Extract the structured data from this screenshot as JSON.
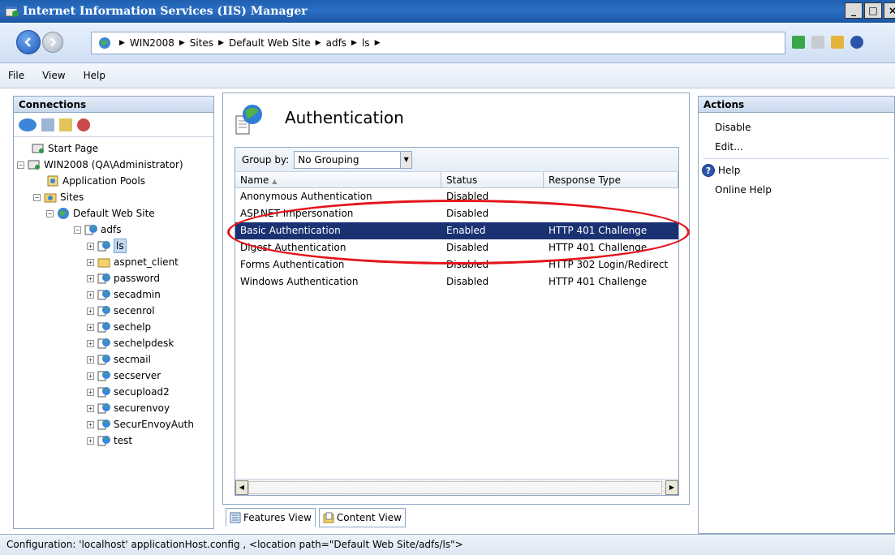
{
  "window": {
    "title": "Internet Information Services (IIS) Manager"
  },
  "address": {
    "crumbs": [
      "WIN2008",
      "Sites",
      "Default Web Site",
      "adfs",
      "ls"
    ]
  },
  "menu": {
    "file": "File",
    "view": "View",
    "help": "Help"
  },
  "connections": {
    "header": "Connections",
    "tree": {
      "start_page": "Start Page",
      "server": "WIN2008 (QA\\Administrator)",
      "app_pools": "Application Pools",
      "sites": "Sites",
      "default_site": "Default Web Site",
      "adfs": "adfs",
      "ls": "ls",
      "children": [
        "aspnet_client",
        "password",
        "secadmin",
        "secenrol",
        "sechelp",
        "sechelpdesk",
        "secmail",
        "secserver",
        "secupload2",
        "securenvoy",
        "SecurEnvoyAuth",
        "test"
      ]
    }
  },
  "feature": {
    "title": "Authentication",
    "group_by_label": "Group by:",
    "group_by_value": "No Grouping",
    "columns": [
      "Name",
      "Status",
      "Response Type"
    ],
    "rows": [
      {
        "name": "Anonymous Authentication",
        "status": "Disabled",
        "response": ""
      },
      {
        "name": "ASP.NET Impersonation",
        "status": "Disabled",
        "response": ""
      },
      {
        "name": "Basic Authentication",
        "status": "Enabled",
        "response": "HTTP 401 Challenge"
      },
      {
        "name": "Digest Authentication",
        "status": "Disabled",
        "response": "HTTP 401 Challenge"
      },
      {
        "name": "Forms Authentication",
        "status": "Disabled",
        "response": "HTTP 302 Login/Redirect"
      },
      {
        "name": "Windows Authentication",
        "status": "Disabled",
        "response": "HTTP 401 Challenge"
      }
    ]
  },
  "view_tabs": {
    "features": "Features View",
    "content": "Content View"
  },
  "actions": {
    "header": "Actions",
    "disable": "Disable",
    "edit": "Edit...",
    "help": "Help",
    "online_help": "Online Help"
  },
  "status": {
    "text": "Configuration: 'localhost' applicationHost.config , <location path=\"Default Web Site/adfs/ls\">"
  },
  "colors": {
    "selection": "#1a3272",
    "highlight_ellipse": "#e3141b",
    "titlebar": "#1f5fb0"
  }
}
